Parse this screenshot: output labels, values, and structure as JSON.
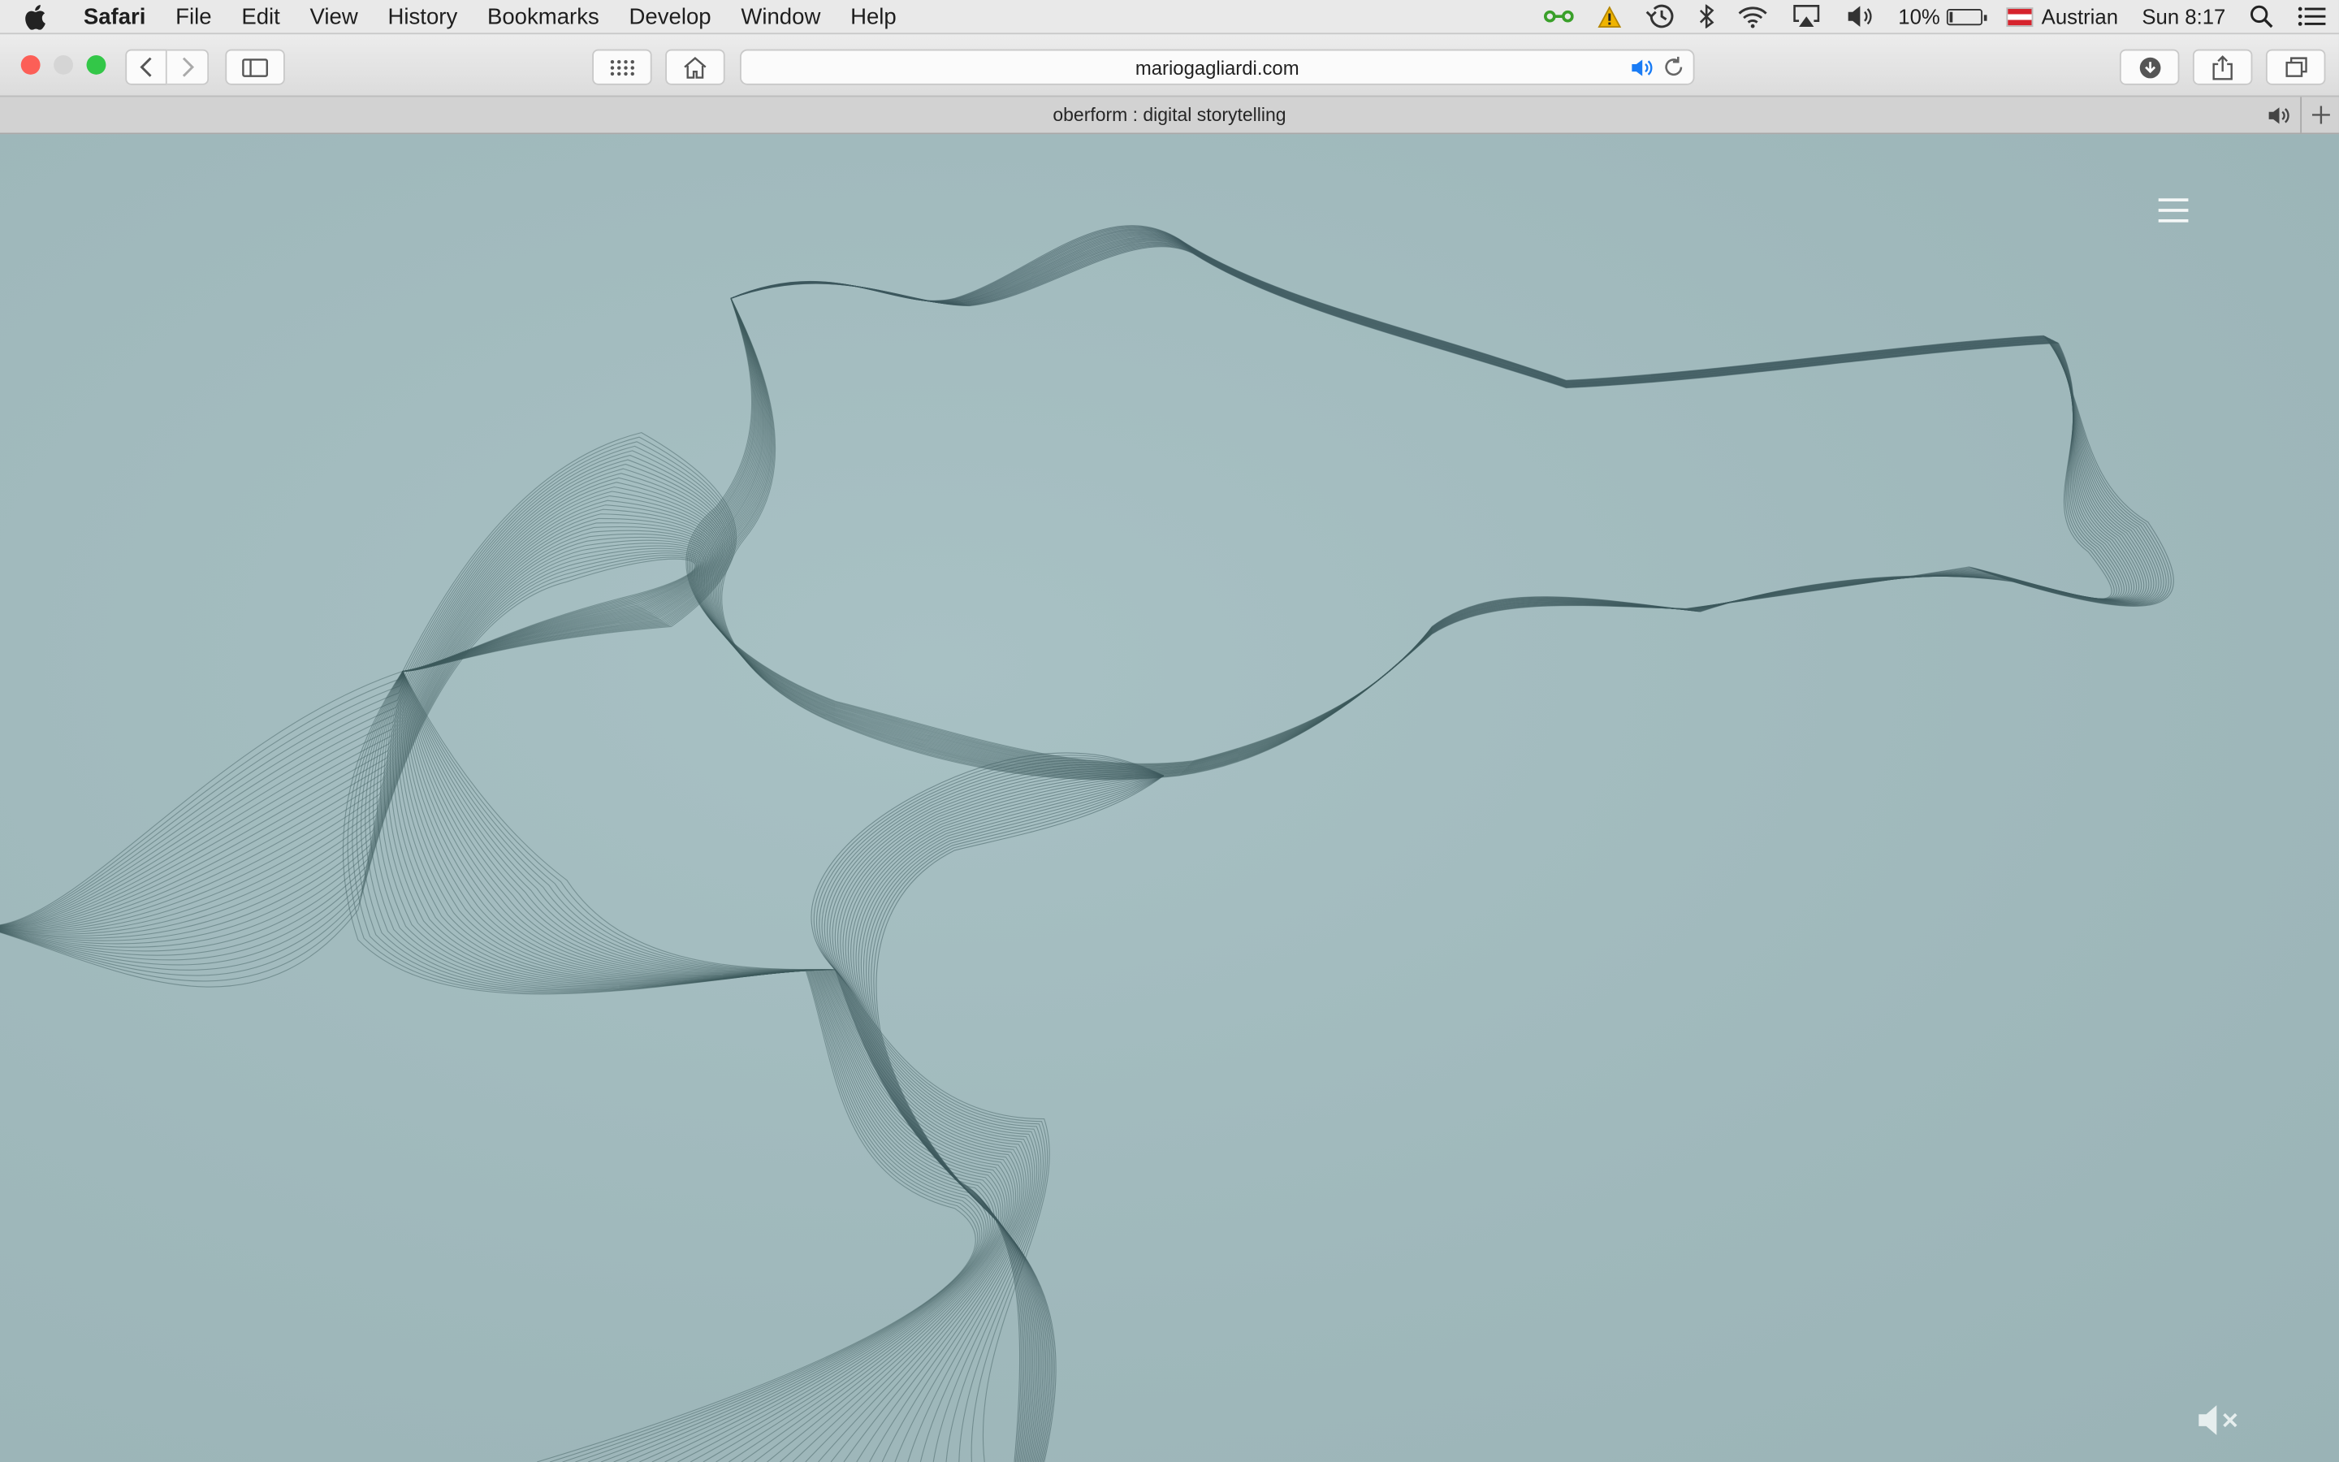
{
  "menubar": {
    "app_name": "Safari",
    "items": [
      "File",
      "Edit",
      "View",
      "History",
      "Bookmarks",
      "Develop",
      "Window",
      "Help"
    ],
    "battery_percent": "10%",
    "battery_level": 0.1,
    "input_source": "Austrian",
    "clock": "Sun 8:17"
  },
  "browser": {
    "url": "mariogagliardi.com",
    "tab_title": "oberform : digital storytelling"
  },
  "colors": {
    "background": "#9fb8bb",
    "ribbon": "#3e5a5e",
    "traffic_close": "#fc5f57",
    "traffic_min": "#d5d5d5",
    "traffic_max": "#33c748"
  },
  "icons": {
    "menu": "hamburger-menu-icon",
    "sound": "speaker-muted-icon"
  }
}
